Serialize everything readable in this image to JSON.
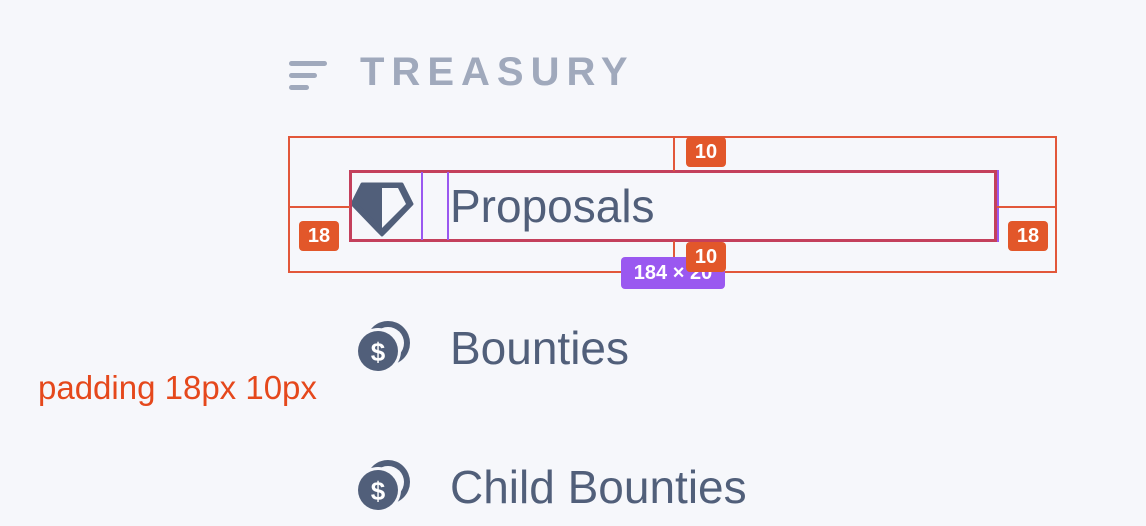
{
  "section": {
    "title": "TREASURY",
    "icon": "menu-lines-icon"
  },
  "nav": {
    "items": [
      {
        "label": "Proposals",
        "icon": "diamond-icon"
      },
      {
        "label": "Bounties",
        "icon": "coins-dollar-icon"
      },
      {
        "label": "Child Bounties",
        "icon": "coins-dollar-icon"
      }
    ]
  },
  "inspector": {
    "margin_top": "10",
    "margin_bottom": "10",
    "margin_left": "18",
    "margin_right": "18",
    "size_label": "184 × 20",
    "note": "padding 18px 10px"
  },
  "colors": {
    "background": "#f6f7fb",
    "header_text": "#a0a9bc",
    "nav_text": "#515f7a",
    "overlay_margin": "#e2573a",
    "overlay_content": "#9a58f0",
    "note_text": "#e5481c"
  }
}
